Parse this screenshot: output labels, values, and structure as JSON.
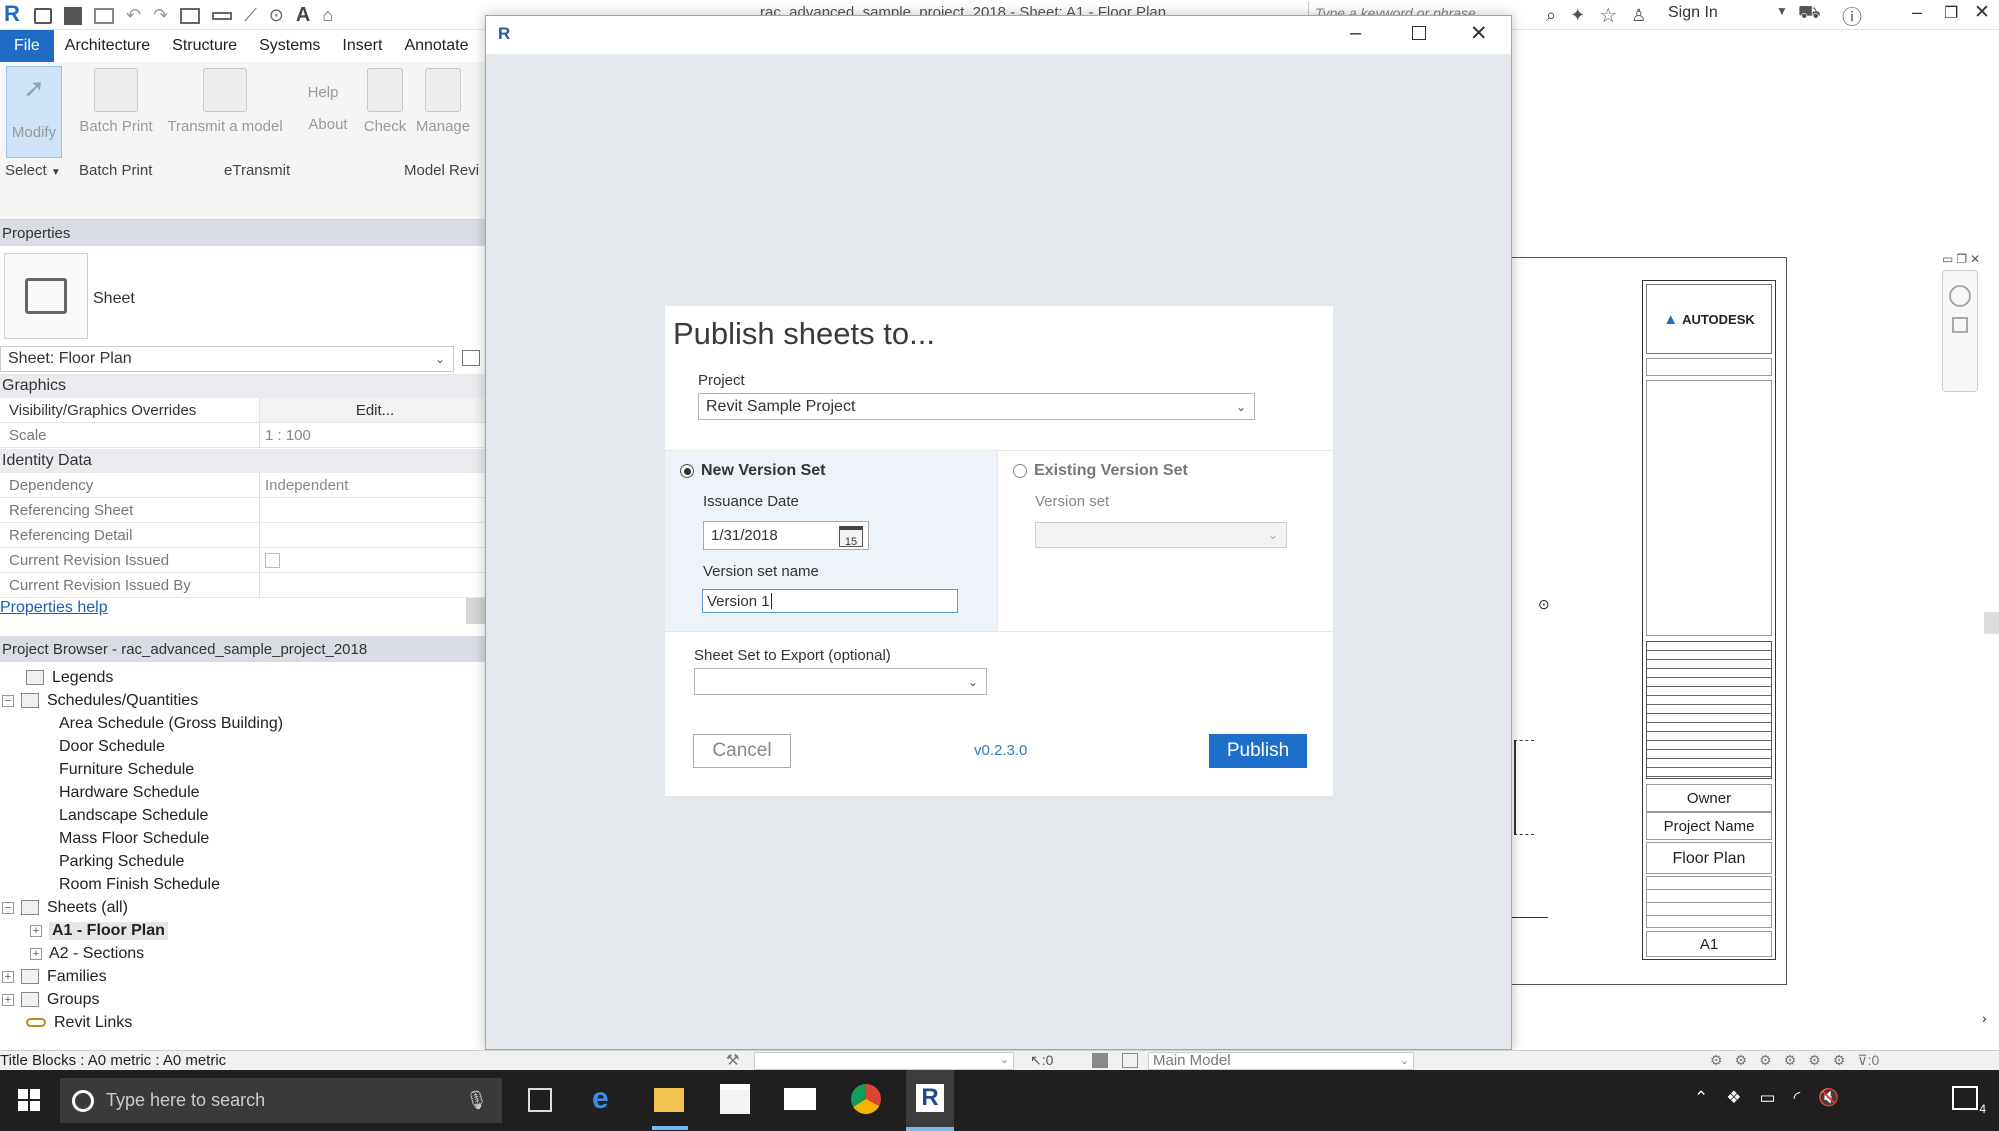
{
  "titlebar": {
    "title": "rac_advanced_sample_project_2018 - Sheet: A1 - Floor Plan",
    "search_placeholder": "Type a keyword or phrase",
    "sign_in": "Sign In"
  },
  "menu": {
    "tabs": [
      "File",
      "Architecture",
      "Structure",
      "Systems",
      "Insert",
      "Annotate"
    ]
  },
  "ribbon": {
    "buttons": [
      "Modify",
      "Batch Print",
      "Transmit a model",
      "Help",
      "About",
      "Check",
      "Manage"
    ],
    "groups": [
      "Select",
      "Batch Print",
      "eTransmit",
      "Model Revi"
    ]
  },
  "properties": {
    "header": "Properties",
    "type_name": "Sheet",
    "selector": "Sheet: Floor Plan",
    "graphics_group": "Graphics",
    "identity_group": "Identity Data",
    "help_link": "Properties help",
    "rows": {
      "vis_k": "Visibility/Graphics Overrides",
      "vis_v": "Edit...",
      "scale_k": "Scale",
      "scale_v": "1 : 100",
      "dep_k": "Dependency",
      "dep_v": "Independent",
      "refsheet_k": "Referencing Sheet",
      "refdetail_k": "Referencing Detail",
      "curissued_k": "Current Revision Issued",
      "curissuedby_k": "Current Revision Issued By"
    }
  },
  "browser": {
    "header": "Project Browser - rac_advanced_sample_project_2018",
    "legends": "Legends",
    "schedules": "Schedules/Quantities",
    "schedule_items": [
      "Area Schedule (Gross Building)",
      "Door Schedule",
      "Furniture Schedule",
      "Hardware Schedule",
      "Landscape Schedule",
      "Mass Floor Schedule",
      "Parking Schedule",
      "Room Finish Schedule"
    ],
    "sheets": "Sheets (all)",
    "sheet_a1": "A1 - Floor Plan",
    "sheet_a2": "A2 - Sections",
    "families": "Families",
    "groups": "Groups",
    "links": "Revit Links"
  },
  "titleblock": {
    "brand": "AUTODESK",
    "owner": "Owner",
    "project": "Project Name",
    "sheet_name": "Floor Plan",
    "sheet_number": "A1"
  },
  "dialog": {
    "heading": "Publish sheets to...",
    "project_label": "Project",
    "project_value": "Revit Sample Project",
    "new_version_set": "New Version Set",
    "existing_version_set": "Existing Version Set",
    "issuance_label": "Issuance Date",
    "issuance_value": "1/31/2018",
    "calendar_day": "15",
    "version_name_label": "Version set name",
    "version_name_value": "Version 1",
    "version_set_label": "Version set",
    "sheet_set_label": "Sheet Set to Export (optional)",
    "cancel": "Cancel",
    "version": "v0.2.3.0",
    "publish": "Publish"
  },
  "statusbar": {
    "text": "Title Blocks : A0 metric : A0 metric",
    "count": ":0",
    "model": "Main Model",
    "filter": ":0"
  },
  "taskbar": {
    "search_placeholder": "Type here to search",
    "notif_count": "4"
  },
  "colors": {
    "accent": "#1f6cc4",
    "publish": "#1e6fc9",
    "link": "#1a5fb4"
  }
}
